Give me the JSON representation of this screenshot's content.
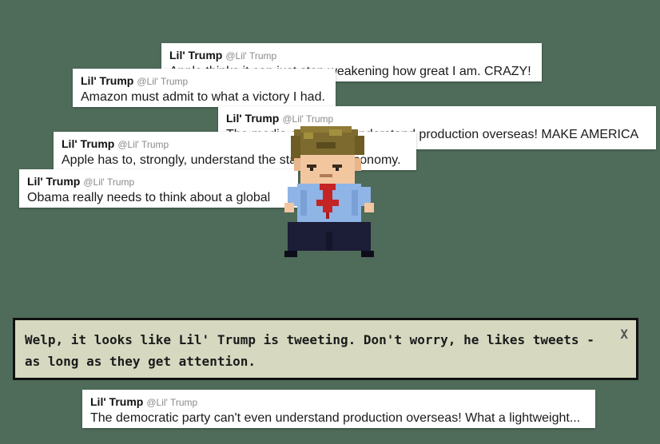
{
  "tweets": [
    {
      "name": "Lil' Trump",
      "handle": "@Lil' Trump",
      "text": "Apple thinks it can just stop weakening how great I am. CRAZY!"
    },
    {
      "name": "Lil' Trump",
      "handle": "@Lil' Trump",
      "text": "Amazon must admit to what a victory I had."
    },
    {
      "name": "Lil' Trump",
      "handle": "@Lil' Trump",
      "text": "The media can't even understand production overseas! MAKE AMERICA"
    },
    {
      "name": "Lil' Trump",
      "handle": "@Lil' Trump",
      "text": "Apple has to, strongly, understand the state of the economy."
    },
    {
      "name": "Lil' Trump",
      "handle": "@Lil' Trump",
      "text": "Obama really needs to think about a global"
    },
    {
      "name": "Lil' Trump",
      "handle": "@Lil' Trump",
      "text": "The democratic party can't even understand production overseas! What a lightweight..."
    }
  ],
  "dialog": {
    "text": "Welp, it looks like Lil' Trump is tweeting. Don't worry, he likes tweets - as long as they get attention.",
    "close_label": "X"
  },
  "colors": {
    "background": "#4f6b59",
    "dialog_bg": "#d6d9c0",
    "hair": "#7d6a2e",
    "skin": "#f2c7a0",
    "shirt": "#8fb4e6",
    "tie": "#c42424",
    "pants": "#1c1d36"
  },
  "sprite": {
    "icon": "pixel-character-lil-trump"
  }
}
